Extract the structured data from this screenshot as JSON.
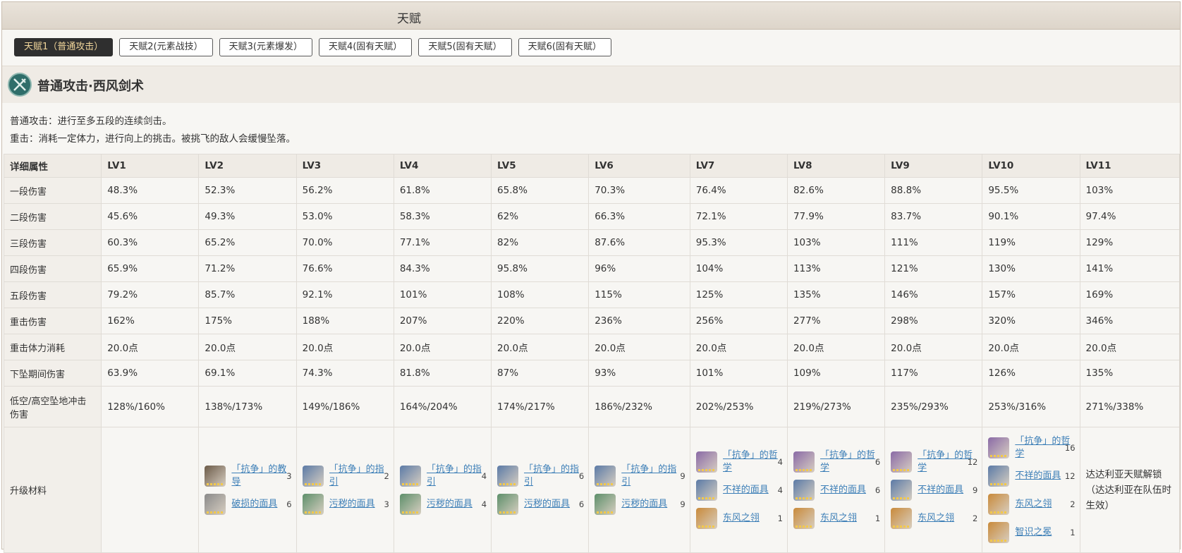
{
  "title": "天赋",
  "tabs": [
    "天赋1（普通攻击）",
    "天赋2(元素战技）",
    "天赋3(元素爆发）",
    "天赋4(固有天赋）",
    "天赋5(固有天赋）",
    "天赋6(固有天赋）"
  ],
  "active_tab": 0,
  "skill": {
    "icon": "sword-skill-icon",
    "name": "普通攻击·西风剑术",
    "desc": [
      "普通攻击：进行至多五段的连续剑击。",
      "重击：消耗一定体力，进行向上的挑击。被挑飞的敌人会缓慢坠落。"
    ]
  },
  "table": {
    "header": [
      "详细属性",
      "LV1",
      "LV2",
      "LV3",
      "LV4",
      "LV5",
      "LV6",
      "LV7",
      "LV8",
      "LV9",
      "LV10",
      "LV11"
    ],
    "rows": [
      [
        "一段伤害",
        "48.3%",
        "52.3%",
        "56.2%",
        "61.8%",
        "65.8%",
        "70.3%",
        "76.4%",
        "82.6%",
        "88.8%",
        "95.5%",
        "103%"
      ],
      [
        "二段伤害",
        "45.6%",
        "49.3%",
        "53.0%",
        "58.3%",
        "62%",
        "66.3%",
        "72.1%",
        "77.9%",
        "83.7%",
        "90.1%",
        "97.4%"
      ],
      [
        "三段伤害",
        "60.3%",
        "65.2%",
        "70.0%",
        "77.1%",
        "82%",
        "87.6%",
        "95.3%",
        "103%",
        "111%",
        "119%",
        "129%"
      ],
      [
        "四段伤害",
        "65.9%",
        "71.2%",
        "76.6%",
        "84.3%",
        "95.8%",
        "96%",
        "104%",
        "113%",
        "121%",
        "130%",
        "141%"
      ],
      [
        "五段伤害",
        "79.2%",
        "85.7%",
        "92.1%",
        "101%",
        "108%",
        "115%",
        "125%",
        "135%",
        "146%",
        "157%",
        "169%"
      ],
      [
        "重击伤害",
        "162%",
        "175%",
        "188%",
        "207%",
        "220%",
        "236%",
        "256%",
        "277%",
        "298%",
        "320%",
        "346%"
      ],
      [
        "重击体力消耗",
        "20.0点",
        "20.0点",
        "20.0点",
        "20.0点",
        "20.0点",
        "20.0点",
        "20.0点",
        "20.0点",
        "20.0点",
        "20.0点",
        "20.0点"
      ],
      [
        "下坠期间伤害",
        "63.9%",
        "69.1%",
        "74.3%",
        "81.8%",
        "87%",
        "93%",
        "101%",
        "109%",
        "117%",
        "126%",
        "135%"
      ],
      [
        "低空/高空坠地冲击伤害",
        "128%/160%",
        "138%/173%",
        "149%/186%",
        "164%/204%",
        "174%/217%",
        "186%/232%",
        "202%/253%",
        "219%/273%",
        "235%/293%",
        "253%/316%",
        "271%/338%"
      ]
    ],
    "materials_label": "升级材料",
    "materials": [
      [],
      [
        {
          "name": "「抗争」的教导",
          "count": "3",
          "icon": "book-bronze-icon",
          "color": "#6b5a48"
        },
        {
          "name": "破损的面具",
          "count": "6",
          "icon": "mask-gray-icon",
          "color": "#8a8a8a"
        }
      ],
      [
        {
          "name": "「抗争」的指引",
          "count": "2",
          "icon": "book-blue-icon",
          "color": "#5b7aa6"
        },
        {
          "name": "污秽的面具",
          "count": "3",
          "icon": "mask-green-icon",
          "color": "#5d8f6a"
        }
      ],
      [
        {
          "name": "「抗争」的指引",
          "count": "4",
          "icon": "book-blue-icon",
          "color": "#5b7aa6"
        },
        {
          "name": "污秽的面具",
          "count": "4",
          "icon": "mask-green-icon",
          "color": "#5d8f6a"
        }
      ],
      [
        {
          "name": "「抗争」的指引",
          "count": "6",
          "icon": "book-blue-icon",
          "color": "#5b7aa6"
        },
        {
          "name": "污秽的面具",
          "count": "6",
          "icon": "mask-green-icon",
          "color": "#5d8f6a"
        }
      ],
      [
        {
          "name": "「抗争」的指引",
          "count": "9",
          "icon": "book-blue-icon",
          "color": "#5b7aa6"
        },
        {
          "name": "污秽的面具",
          "count": "9",
          "icon": "mask-green-icon",
          "color": "#5d8f6a"
        }
      ],
      [
        {
          "name": "「抗争」的哲学",
          "count": "4",
          "icon": "book-purple-icon",
          "color": "#8a6aa6"
        },
        {
          "name": "不祥的面具",
          "count": "4",
          "icon": "mask-blue-icon",
          "color": "#5b7aa6"
        },
        {
          "name": "东风之翎",
          "count": "1",
          "icon": "feather-icon",
          "color": "#c98a3a"
        }
      ],
      [
        {
          "name": "「抗争」的哲学",
          "count": "6",
          "icon": "book-purple-icon",
          "color": "#8a6aa6"
        },
        {
          "name": "不祥的面具",
          "count": "6",
          "icon": "mask-blue-icon",
          "color": "#5b7aa6"
        },
        {
          "name": "东风之翎",
          "count": "1",
          "icon": "feather-icon",
          "color": "#c98a3a"
        }
      ],
      [
        {
          "name": "「抗争」的哲学",
          "count": "12",
          "icon": "book-purple-icon",
          "color": "#8a6aa6"
        },
        {
          "name": "不祥的面具",
          "count": "9",
          "icon": "mask-blue-icon",
          "color": "#5b7aa6"
        },
        {
          "name": "东风之翎",
          "count": "2",
          "icon": "feather-icon",
          "color": "#c98a3a"
        }
      ],
      [
        {
          "name": "「抗争」的哲学",
          "count": "16",
          "icon": "book-purple-icon",
          "color": "#8a6aa6"
        },
        {
          "name": "不祥的面具",
          "count": "12",
          "icon": "mask-blue-icon",
          "color": "#5b7aa6"
        },
        {
          "name": "东风之翎",
          "count": "2",
          "icon": "feather-icon",
          "color": "#c98a3a"
        },
        {
          "name": "智识之冕",
          "count": "1",
          "icon": "crown-icon",
          "color": "#c98a3a"
        }
      ]
    ],
    "lv11_note": "达达利亚天赋解锁（达达利亚在队伍时生效）"
  }
}
